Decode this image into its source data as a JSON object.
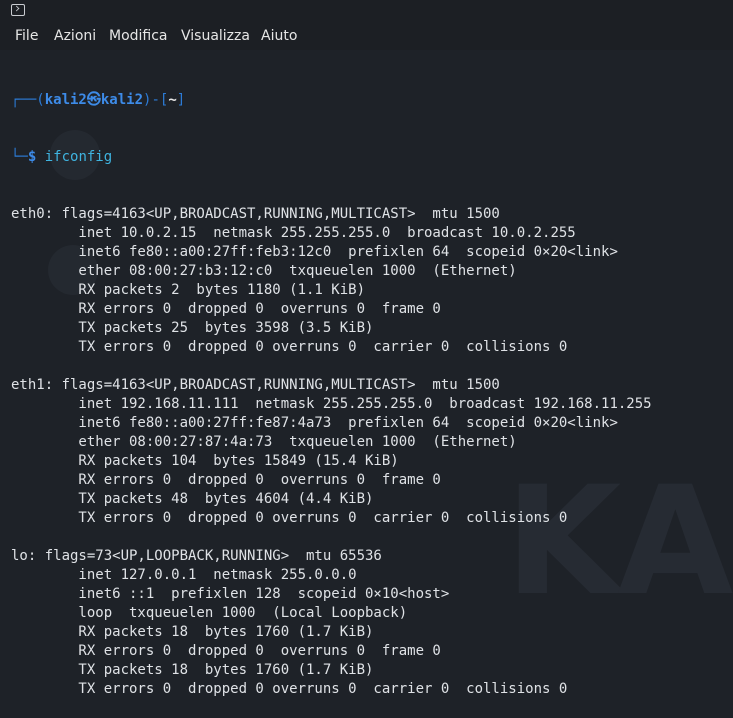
{
  "menu": [
    "File",
    "Azioni",
    "Modifica",
    "Visualizza",
    "Aiuto"
  ],
  "prompt": {
    "user": "kali2",
    "at": "㉿",
    "host": "kali2",
    "cwd": "~",
    "symbol": "$",
    "command": "ifconfig"
  },
  "output": [
    "eth0: flags=4163<UP,BROADCAST,RUNNING,MULTICAST>  mtu 1500",
    "        inet 10.0.2.15  netmask 255.255.255.0  broadcast 10.0.2.255",
    "        inet6 fe80::a00:27ff:feb3:12c0  prefixlen 64  scopeid 0×20<link>",
    "        ether 08:00:27:b3:12:c0  txqueuelen 1000  (Ethernet)",
    "        RX packets 2  bytes 1180 (1.1 KiB)",
    "        RX errors 0  dropped 0  overruns 0  frame 0",
    "        TX packets 25  bytes 3598 (3.5 KiB)",
    "        TX errors 0  dropped 0 overruns 0  carrier 0  collisions 0",
    "",
    "eth1: flags=4163<UP,BROADCAST,RUNNING,MULTICAST>  mtu 1500",
    "        inet 192.168.11.111  netmask 255.255.255.0  broadcast 192.168.11.255",
    "        inet6 fe80::a00:27ff:fe87:4a73  prefixlen 64  scopeid 0×20<link>",
    "        ether 08:00:27:87:4a:73  txqueuelen 1000  (Ethernet)",
    "        RX packets 104  bytes 15849 (15.4 KiB)",
    "        RX errors 0  dropped 0  overruns 0  frame 0",
    "        TX packets 48  bytes 4604 (4.4 KiB)",
    "        TX errors 0  dropped 0 overruns 0  carrier 0  collisions 0",
    "",
    "lo: flags=73<UP,LOOPBACK,RUNNING>  mtu 65536",
    "        inet 127.0.0.1  netmask 255.0.0.0",
    "        inet6 ::1  prefixlen 128  scopeid 0×10<host>",
    "        loop  txqueuelen 1000  (Local Loopback)",
    "        RX packets 18  bytes 1760 (1.7 KiB)",
    "        RX errors 0  dropped 0  overruns 0  frame 0",
    "        TX packets 18  bytes 1760 (1.7 KiB)",
    "        TX errors 0  dropped 0 overruns 0  carrier 0  collisions 0"
  ],
  "watermark": "KA",
  "colors": {
    "background": "#1e2228",
    "prompt_blue": "#3d8be8",
    "command_cyan": "#3fb4e0",
    "text": "#dfe2e6"
  }
}
